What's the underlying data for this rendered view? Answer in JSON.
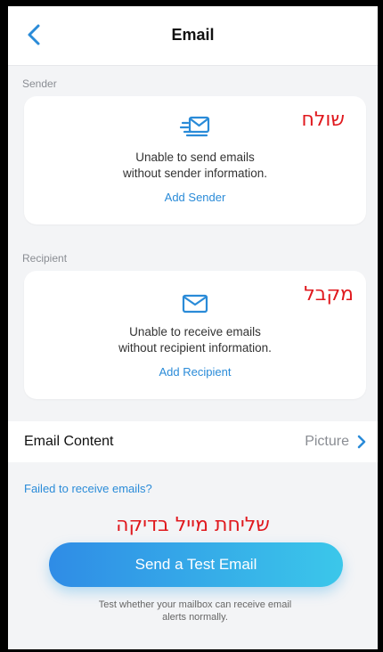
{
  "header": {
    "title": "Email",
    "back_icon": "chevron-left-icon"
  },
  "sender": {
    "section_label": "Sender",
    "icon": "email-send-icon",
    "message_line1": "Unable to send emails",
    "message_line2": "without sender information.",
    "action_label": "Add Sender",
    "hebrew_annotation": "שולח"
  },
  "recipient": {
    "section_label": "Recipient",
    "icon": "email-icon",
    "message_line1": "Unable to receive emails",
    "message_line2": "without recipient information.",
    "action_label": "Add Recipient",
    "hebrew_annotation": "מקבל"
  },
  "email_content": {
    "label": "Email Content",
    "value": "Picture"
  },
  "failed_link": "Failed to receive emails?",
  "test": {
    "hebrew_annotation": "שליחת מייל בדיקה",
    "button_label": "Send a Test Email",
    "hint_line1": "Test whether your mailbox can receive email",
    "hint_line2": "alerts normally."
  },
  "colors": {
    "accent": "#2a8bd8",
    "annotation_red": "#e0191e",
    "gradient_start": "#2f8ce6",
    "gradient_end": "#3bc7ea"
  }
}
